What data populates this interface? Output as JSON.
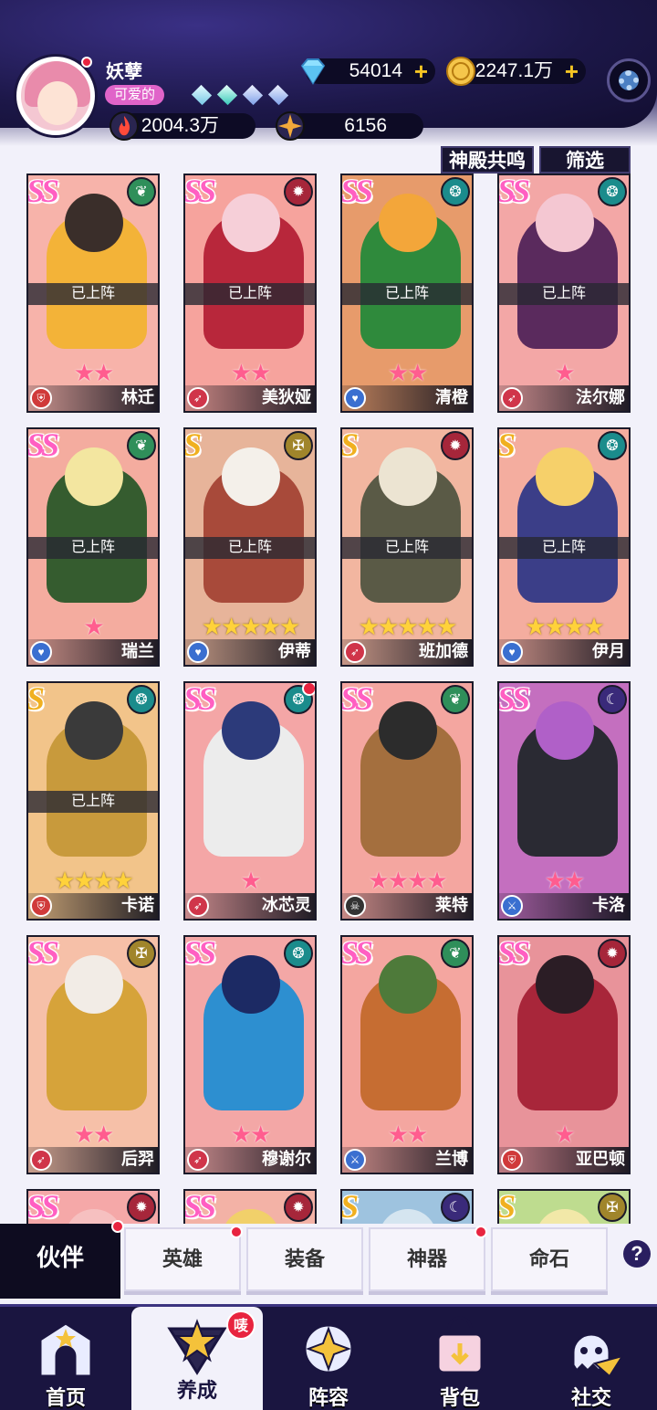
{
  "player": {
    "name": "妖孽",
    "tag": "可爱的",
    "diamonds": "54014",
    "gold": "2247.1万",
    "power": "2004.3万",
    "stars": "6156"
  },
  "top_buttons": {
    "resonance": "神殿共鸣",
    "filter": "筛选"
  },
  "colors": {
    "accent_pink": "#ff5fc2",
    "rank_gold": "#f0b020",
    "header_dark": "#1a1540",
    "notification_red": "#e8243f"
  },
  "heroes": [
    {
      "rank": "SS",
      "element": "nature",
      "elem_icon": "leaf-icon",
      "status": "已上阵",
      "stars": 2,
      "star_color": "pink",
      "class_icon": "shield-icon",
      "name": "林迁",
      "art": [
        "#f3b338",
        "#3a2e2a"
      ],
      "bg": "#f7b3aa"
    },
    {
      "rank": "SS",
      "element": "fire",
      "elem_icon": "flame-icon",
      "status": "已上阵",
      "stars": 2,
      "star_color": "pink",
      "class_icon": "bow-icon",
      "name": "美狄娅",
      "art": [
        "#b8273b",
        "#f6cfd8"
      ],
      "bg": "#f6a39d"
    },
    {
      "rank": "SS",
      "element": "water",
      "elem_icon": "swirl-icon",
      "status": "已上阵",
      "stars": 2,
      "star_color": "pink",
      "class_icon": "heart-icon",
      "name": "清橙",
      "art": [
        "#2f8a3c",
        "#f3a63a"
      ],
      "bg": "#e79b6b"
    },
    {
      "rank": "SS",
      "element": "water",
      "elem_icon": "swirl-icon",
      "status": "已上阵",
      "stars": 1,
      "star_color": "pink",
      "class_icon": "bow-icon",
      "name": "法尔娜",
      "art": [
        "#5a2a5d",
        "#f4c7d2"
      ],
      "bg": "#f3a7a6"
    },
    {
      "rank": "SS",
      "element": "nature",
      "elem_icon": "leaf-icon",
      "status": "已上阵",
      "stars": 1,
      "star_color": "pink",
      "class_icon": "heart-icon",
      "name": "瑞兰",
      "art": [
        "#355c2f",
        "#f3e6a0"
      ],
      "bg": "#f4ac9f"
    },
    {
      "rank": "S",
      "element": "light",
      "elem_icon": "cross-icon",
      "status": "已上阵",
      "stars": 5,
      "star_color": "gold",
      "class_icon": "heart-icon",
      "name": "伊蒂",
      "art": [
        "#a84a3a",
        "#f4f0ea"
      ],
      "bg": "#e7b49a"
    },
    {
      "rank": "S",
      "element": "fire",
      "elem_icon": "flame-icon",
      "status": "已上阵",
      "stars": 5,
      "star_color": "gold",
      "class_icon": "bow-icon",
      "name": "班加德",
      "art": [
        "#5a5a46",
        "#ece4d2"
      ],
      "bg": "#f2b6a0"
    },
    {
      "rank": "S",
      "element": "water",
      "elem_icon": "swirl-icon",
      "status": "已上阵",
      "stars": 4,
      "star_color": "gold",
      "class_icon": "heart-icon",
      "name": "伊月",
      "art": [
        "#3b3e88",
        "#f6d06a"
      ],
      "bg": "#f4ad9f"
    },
    {
      "rank": "S",
      "element": "water",
      "elem_icon": "swirl-icon",
      "status": "已上阵",
      "stars": 4,
      "star_color": "gold",
      "class_icon": "shield-icon",
      "name": "卡诺",
      "art": [
        "#c89a3c",
        "#3a3a3a"
      ],
      "bg": "#f2c48a"
    },
    {
      "rank": "SS",
      "element": "water",
      "elem_icon": "swirl-icon",
      "status": "",
      "stars": 1,
      "star_color": "pink",
      "class_icon": "bow-icon",
      "name": "冰芯灵",
      "art": [
        "#ececec",
        "#2c3a7a"
      ],
      "bg": "#f4a6a6",
      "notif": true
    },
    {
      "rank": "SS",
      "element": "nature",
      "elem_icon": "leaf-icon",
      "status": "",
      "stars": 4,
      "star_color": "pink",
      "class_icon": "skull-icon",
      "name": "莱特",
      "art": [
        "#a46f3e",
        "#2c2c2c"
      ],
      "bg": "#f4a6a0"
    },
    {
      "rank": "SS",
      "element": "dark",
      "elem_icon": "moon-icon",
      "status": "",
      "stars": 2,
      "star_color": "pink",
      "class_icon": "sword-icon",
      "name": "卡洛",
      "art": [
        "#2a2a33",
        "#b060c8"
      ],
      "bg": "#c46fbf"
    },
    {
      "rank": "SS",
      "element": "light",
      "elem_icon": "cross-icon",
      "status": "",
      "stars": 2,
      "star_color": "pink",
      "class_icon": "bow-icon",
      "name": "后羿",
      "art": [
        "#d6a33a",
        "#f2ece6"
      ],
      "bg": "#f6c0a8"
    },
    {
      "rank": "SS",
      "element": "water",
      "elem_icon": "swirl-icon",
      "status": "",
      "stars": 2,
      "star_color": "pink",
      "class_icon": "bow-icon",
      "name": "穆谢尔",
      "art": [
        "#2d8fd0",
        "#1c2a64"
      ],
      "bg": "#f3a7a6"
    },
    {
      "rank": "SS",
      "element": "nature",
      "elem_icon": "leaf-icon",
      "status": "",
      "stars": 2,
      "star_color": "pink",
      "class_icon": "sword-icon",
      "name": "兰博",
      "art": [
        "#c66d32",
        "#4e7a3a"
      ],
      "bg": "#f4a6a0"
    },
    {
      "rank": "SS",
      "element": "fire",
      "elem_icon": "flame-icon",
      "status": "",
      "stars": 1,
      "star_color": "pink",
      "class_icon": "shield-icon",
      "name": "亚巴顿",
      "art": [
        "#a8263a",
        "#2b1d25"
      ],
      "bg": "#e8939a"
    },
    {
      "rank": "SS",
      "element": "fire",
      "elem_icon": "flame-icon",
      "status": "",
      "stars": 0,
      "star_color": "pink",
      "class_icon": "",
      "name": "",
      "art": [
        "#e26b75",
        "#f6c0c0"
      ],
      "bg": "#f5a8a8"
    },
    {
      "rank": "SS",
      "element": "fire",
      "elem_icon": "flame-icon",
      "status": "",
      "stars": 0,
      "star_color": "pink",
      "class_icon": "",
      "name": "",
      "art": [
        "#c8302f",
        "#f1d06a"
      ],
      "bg": "#f3b2a6"
    },
    {
      "rank": "S",
      "element": "dark",
      "elem_icon": "moon-icon",
      "status": "",
      "stars": 0,
      "star_color": "gold",
      "class_icon": "",
      "name": "",
      "art": [
        "#3b5a8a",
        "#d5e5f0"
      ],
      "bg": "#9ec3df"
    },
    {
      "rank": "S",
      "element": "light",
      "elem_icon": "cross-icon",
      "status": "",
      "stars": 0,
      "star_color": "gold",
      "class_icon": "",
      "name": "",
      "art": [
        "#76b348",
        "#f2e8a8"
      ],
      "bg": "#bedc8f"
    }
  ],
  "subtabs": [
    {
      "label": "伙伴",
      "active": true,
      "dot": true
    },
    {
      "label": "英雄",
      "active": false,
      "dot": true
    },
    {
      "label": "装备",
      "active": false,
      "dot": false
    },
    {
      "label": "神器",
      "active": false,
      "dot": true
    },
    {
      "label": "命石",
      "active": false,
      "dot": false
    }
  ],
  "help_label": "?",
  "nav": [
    {
      "label": "首页",
      "icon": "castle-icon",
      "active": false
    },
    {
      "label": "养成",
      "icon": "star-upgrade-icon",
      "active": true,
      "badge": "唛"
    },
    {
      "label": "阵容",
      "icon": "formation-icon",
      "active": false
    },
    {
      "label": "背包",
      "icon": "bag-icon",
      "active": false
    },
    {
      "label": "社交",
      "icon": "ghost-icon",
      "active": false
    }
  ]
}
